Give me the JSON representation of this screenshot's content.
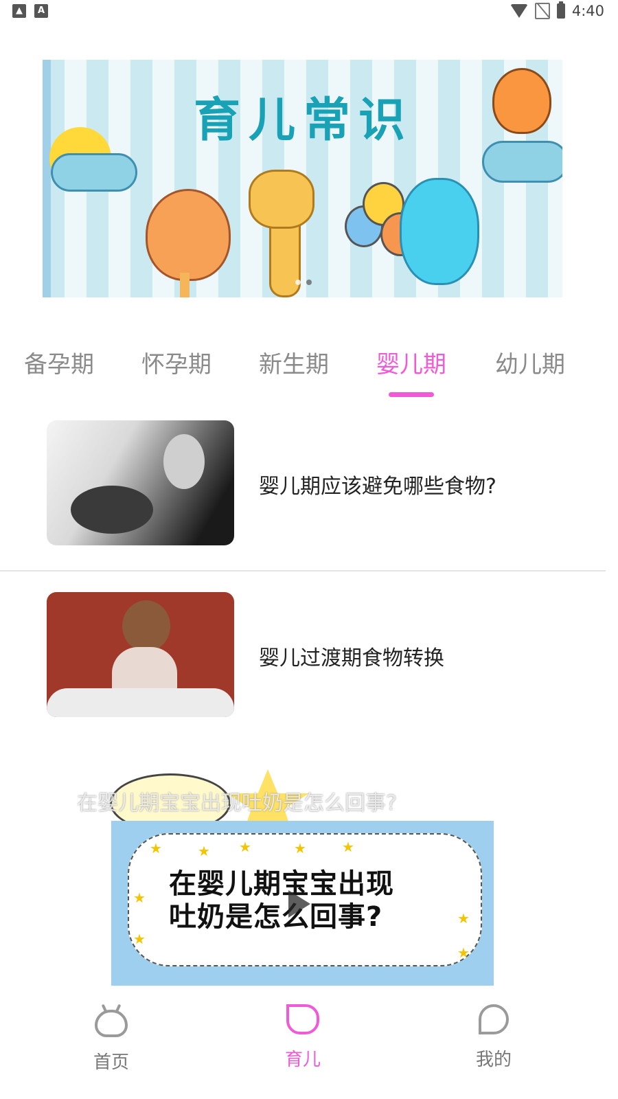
{
  "status_bar": {
    "time": "4:40",
    "left_icons": [
      "image-icon",
      "text-a-icon"
    ],
    "right_icons": [
      "wifi-icon",
      "no-sim-icon",
      "battery-charging-icon"
    ]
  },
  "banner": {
    "title": "育儿常识",
    "page_count": 2,
    "active_page": 2
  },
  "tabs": {
    "items": [
      {
        "label": "备孕期"
      },
      {
        "label": "怀孕期"
      },
      {
        "label": "新生期"
      },
      {
        "label": "婴儿期"
      },
      {
        "label": "幼儿期"
      }
    ],
    "active_index": 3
  },
  "articles": [
    {
      "title": "婴儿期应该避免哪些食物?",
      "thumb": "mother-holding-baby-photo"
    },
    {
      "title": "婴儿过渡期食物转换",
      "thumb": "smiling-toddler-photo"
    }
  ],
  "video": {
    "overlay_title": "在婴儿期宝宝出现吐奶是怎么回事?",
    "card_line1": "在婴儿期宝宝出现",
    "card_line2": "吐奶是怎么回事?"
  },
  "bottom_nav": {
    "items": [
      {
        "label": "首页",
        "icon": "home-bunny-icon"
      },
      {
        "label": "育儿",
        "icon": "stroller-icon"
      },
      {
        "label": "我的",
        "icon": "sprout-icon"
      }
    ],
    "active_index": 1
  },
  "colors": {
    "accent": "#f15ad6",
    "tab_inactive": "#8a8a8a",
    "divider": "#e3e3e3"
  }
}
